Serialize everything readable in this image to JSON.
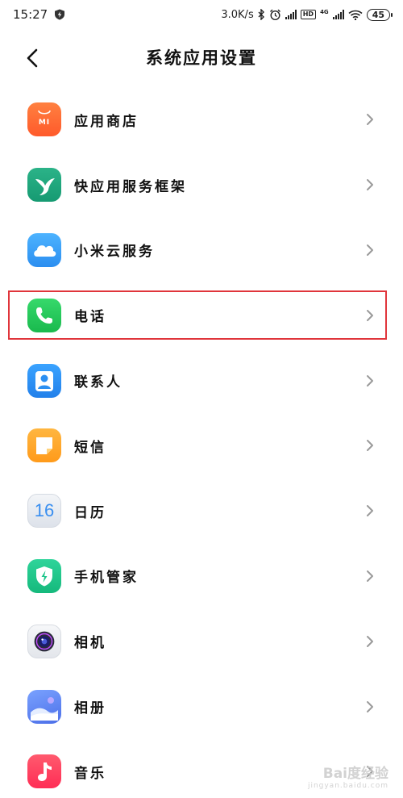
{
  "status_bar": {
    "time": "15:27",
    "net_speed": "3.0K/s",
    "network_type": "4G",
    "hd_label": "HD",
    "battery": "45"
  },
  "header": {
    "title": "系统应用设置"
  },
  "items": [
    {
      "label": "应用商店",
      "icon": "mi-store-icon",
      "icon_text": "MI",
      "color": "#ff6a33"
    },
    {
      "label": "快应用服务框架",
      "icon": "hummingbird-icon",
      "color": "#1fa77e"
    },
    {
      "label": "小米云服务",
      "icon": "cloud-icon",
      "color": "#3aa0f4"
    },
    {
      "label": "电话",
      "icon": "phone-icon",
      "color": "#22c95a"
    },
    {
      "label": "联系人",
      "icon": "contact-icon",
      "color": "#2b8ff2"
    },
    {
      "label": "短信",
      "icon": "message-icon",
      "color": "#ffa829"
    },
    {
      "label": "日历",
      "icon": "calendar-icon",
      "icon_text": "16",
      "color": "#e7ebf1"
    },
    {
      "label": "手机管家",
      "icon": "security-icon",
      "color": "#1ec58b"
    },
    {
      "label": "相机",
      "icon": "camera-icon",
      "color": "#f1f2f5"
    },
    {
      "label": "相册",
      "icon": "gallery-icon",
      "color": "#4c7df0"
    },
    {
      "label": "音乐",
      "icon": "music-icon",
      "color": "#ff3d5f"
    }
  ],
  "highlighted_item": "电话",
  "watermark": {
    "text": "Bai度经验",
    "url": "jingyan.baidu.com"
  }
}
